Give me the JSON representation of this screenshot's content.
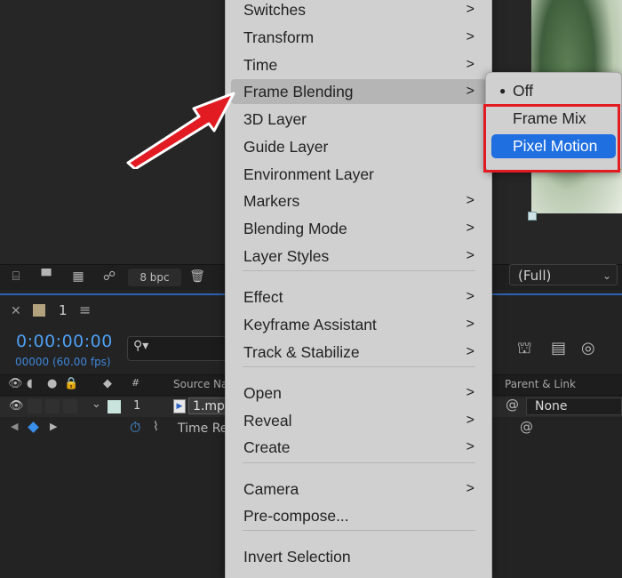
{
  "viewer": {
    "bit_depth": "8 bpc",
    "resolution": "(Full)"
  },
  "timeline": {
    "comp_tab_number": "1",
    "timecode": "0:00:00:00",
    "frame_info": "00000 (60.00 fps)",
    "columns": {
      "source_name": "Source Na",
      "parent_link": "Parent & Link"
    },
    "layer": {
      "number": "1",
      "name": "1.mp",
      "parent": "None"
    },
    "property": {
      "label": "Time Re"
    }
  },
  "context_menu": {
    "items": [
      {
        "label": "Switches",
        "has_submenu": true
      },
      {
        "label": "Transform",
        "has_submenu": true
      },
      {
        "label": "Time",
        "has_submenu": true
      },
      {
        "label": "Frame Blending",
        "has_submenu": true,
        "highlighted": true
      },
      {
        "label": "3D Layer",
        "has_submenu": false
      },
      {
        "label": "Guide Layer",
        "has_submenu": false
      },
      {
        "label": "Environment Layer",
        "has_submenu": false
      },
      {
        "label": "Markers",
        "has_submenu": true
      },
      {
        "label": "Blending Mode",
        "has_submenu": true
      },
      {
        "label": "Layer Styles",
        "has_submenu": true
      },
      {
        "label": "Effect",
        "has_submenu": true
      },
      {
        "label": "Keyframe Assistant",
        "has_submenu": true
      },
      {
        "label": "Track & Stabilize",
        "has_submenu": true
      },
      {
        "label": "Open",
        "has_submenu": true
      },
      {
        "label": "Reveal",
        "has_submenu": true
      },
      {
        "label": "Create",
        "has_submenu": true
      },
      {
        "label": "Camera",
        "has_submenu": true
      },
      {
        "label": "Pre-compose...",
        "has_submenu": false
      },
      {
        "label": "Invert Selection",
        "has_submenu": false
      }
    ],
    "arrow_glyph": ">"
  },
  "submenu": {
    "items": [
      {
        "label": "Off",
        "checked": true
      },
      {
        "label": "Frame Mix",
        "checked": false
      },
      {
        "label": "Pixel Motion",
        "checked": false,
        "selected": true
      }
    ],
    "bullet": "●"
  },
  "colors": {
    "accent_blue": "#1f6fe0",
    "timecode_blue": "#4d9ff3",
    "annotation_red": "#e21b23",
    "menu_bg": "#d0d0d0"
  },
  "icons": {
    "close": "close-icon",
    "panel_menu": "hamburger-icon",
    "search": "search-icon",
    "eye": "eye-icon",
    "audio": "speaker-icon",
    "solo": "solo-icon",
    "lock": "lock-icon",
    "label": "label-icon",
    "stopwatch": "stopwatch-icon",
    "graph": "graph-icon",
    "pickwhip": "pickwhip-icon",
    "trash": "trash-icon",
    "folder": "folder-icon"
  }
}
